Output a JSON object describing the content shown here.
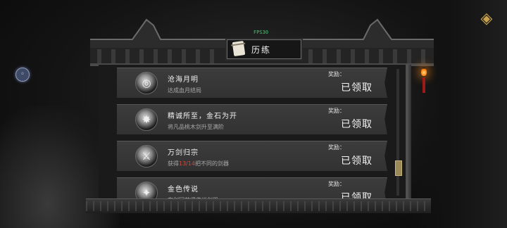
{
  "fps": "FPS30",
  "title": "历练",
  "icons": {
    "back": "back-circle-icon",
    "corner": "diamond-emblem-icon",
    "title": "scroll-icon"
  },
  "colors": {
    "accent_gold": "#c9a24d",
    "highlight_red": "#d8473a",
    "fps_green": "#2fd060"
  },
  "trials": [
    {
      "name": "沧海月明",
      "desc": "达成血月结局",
      "reward_label": "奖励：",
      "status": "已领取",
      "icon": "moon-swirl-icon"
    },
    {
      "name": "精诚所至，金石为开",
      "desc": "将凡品桃木剑升至满阶",
      "reward_label": "奖励：",
      "status": "已领取",
      "icon": "sword-bundle-icon"
    },
    {
      "name": "万剑归宗",
      "desc_prefix": "获得",
      "desc_progress": "13/14",
      "desc_suffix": "把不同的剑器",
      "reward_label": "奖励：",
      "status": "已领取",
      "icon": "swords-rack-icon"
    },
    {
      "name": "金色传说",
      "desc": "在剑冢获得传说剑器",
      "reward_label": "奖励：",
      "status": "已领取",
      "icon": "legend-sword-icon"
    }
  ]
}
